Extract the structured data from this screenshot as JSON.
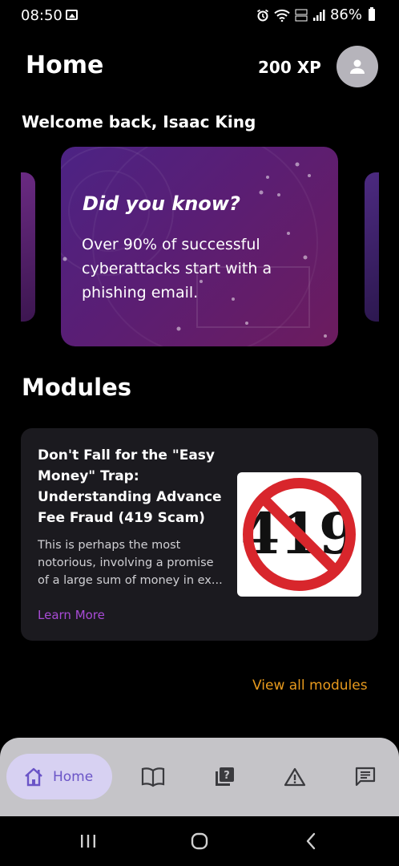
{
  "status_bar": {
    "time": "08:50",
    "battery": "86%"
  },
  "header": {
    "title": "Home",
    "xp": "200 XP"
  },
  "welcome": "Welcome back, Isaac King",
  "fact_card": {
    "title": "Did you know?",
    "body": "Over 90% of successful cyberattacks start with a phishing email."
  },
  "modules": {
    "section_title": "Modules",
    "card": {
      "title": "Don't Fall for the \"Easy Money\" Trap: Understanding Advance Fee Fraud (419 Scam)",
      "description": "This is perhaps the most notorious, involving a promise of a large sum of money in ex...",
      "link": "Learn More",
      "image_text": "419"
    },
    "view_all": "View all modules"
  },
  "bottom_nav": {
    "items": [
      {
        "label": "Home",
        "icon": "home-icon",
        "active": true
      },
      {
        "icon": "book-icon"
      },
      {
        "icon": "quiz-icon"
      },
      {
        "icon": "warning-icon"
      },
      {
        "icon": "chat-icon"
      }
    ]
  },
  "colors": {
    "background": "#000000",
    "accent_purple": "#a84bd6",
    "link_orange": "#e89a1d",
    "nav_bg": "#c5c4c8",
    "nav_active_bg": "#d7d1f2",
    "nav_active_text": "#6a54c7"
  }
}
